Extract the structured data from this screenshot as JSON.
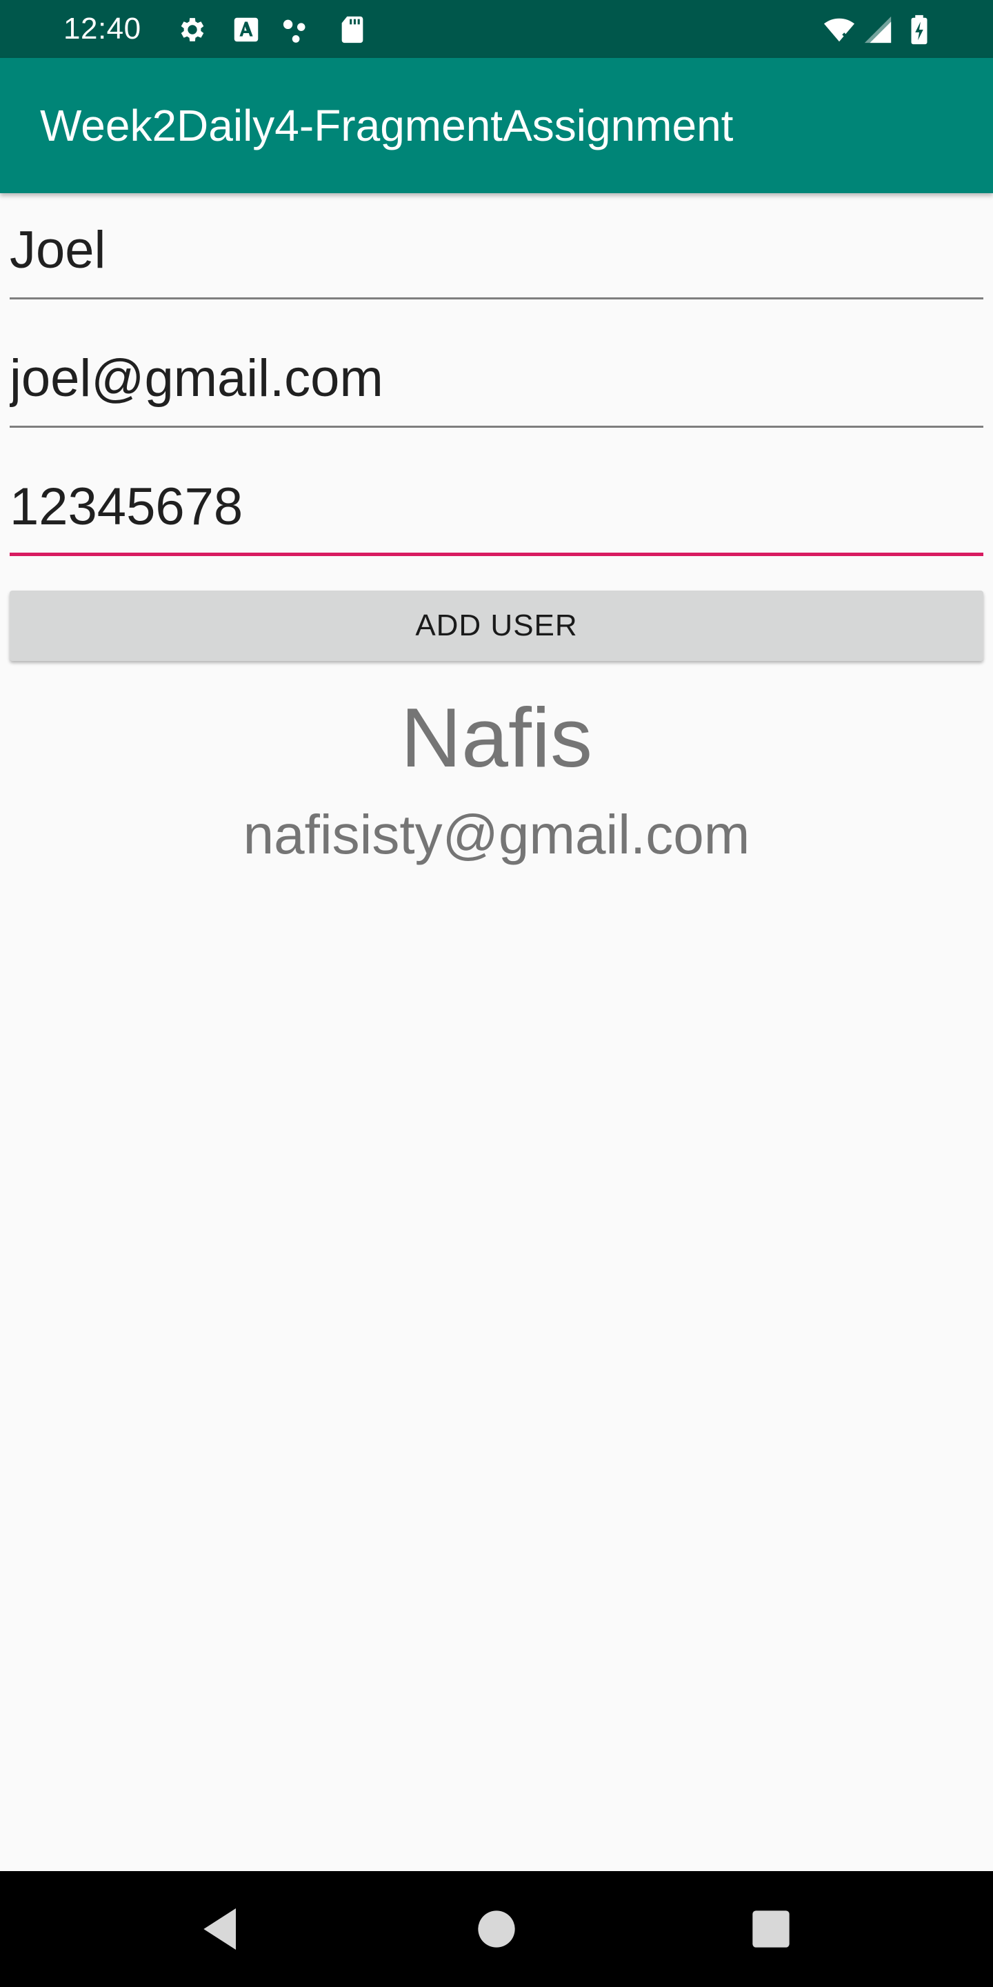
{
  "status_bar": {
    "time": "12:40",
    "left_icons": [
      "settings-icon",
      "font-a-icon",
      "dots-icon",
      "sd-card-icon"
    ],
    "right_icons": [
      "wifi-off-icon",
      "cell-signal-icon",
      "battery-charging-icon"
    ]
  },
  "app_bar": {
    "title": "Week2Daily4-FragmentAssignment",
    "color": "#008577",
    "status_color": "#00574b"
  },
  "form": {
    "name_value": "Joel",
    "email_value": "joel@gmail.com",
    "password_value": "12345678",
    "accent_color": "#d81b60"
  },
  "button": {
    "add_user_label": "ADD USER"
  },
  "user_display": {
    "name": "Nafis",
    "email": "nafisisty@gmail.com"
  },
  "nav_bar": {
    "buttons": [
      "back-icon",
      "home-icon",
      "recents-icon"
    ]
  }
}
